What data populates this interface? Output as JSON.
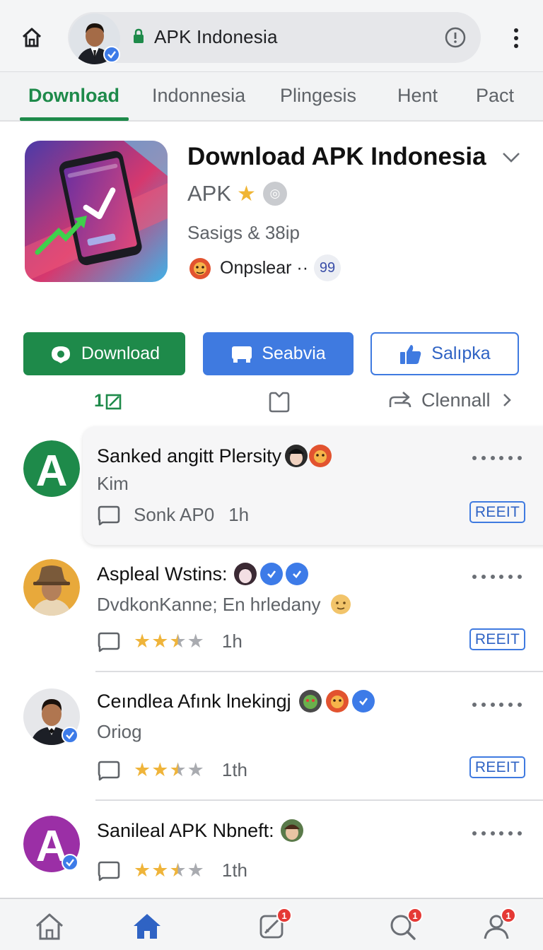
{
  "browser": {
    "url_text": "APK Indonesia"
  },
  "tabs": [
    {
      "label": "Download",
      "active": true
    },
    {
      "label": "Indonnesia",
      "active": false
    },
    {
      "label": "Plingesis",
      "active": false
    },
    {
      "label": "Hent",
      "active": false
    },
    {
      "label": "Pact",
      "active": false
    }
  ],
  "app": {
    "title": "Download APK Indonesia",
    "subtitle": "APK",
    "meta": "Sasigs & 38ip",
    "developer": "Onpslear ··",
    "developer_count": "99"
  },
  "actions": {
    "download_label": "Download",
    "seabvia_label": "Seabvia",
    "salipka_label": "Salıpka"
  },
  "quick": {
    "left_label": "1",
    "right_label": "Clennall"
  },
  "items": [
    {
      "title": "Sanked angitt Plersity",
      "subtitle": "Kim",
      "footer_text": "Sonk AP0",
      "time": "1h",
      "reply_label": "REEIT",
      "avatar_letter": "A",
      "avatar_color": "#1e8a4a"
    },
    {
      "title": "Aspleal Wstins:",
      "subtitle": "DvdkonKanne; En hrledany",
      "rating": 2.5,
      "time": "1h",
      "reply_label": "REEIT"
    },
    {
      "title": "Ceındlea Afınk lnekingj",
      "subtitle": "Oriog",
      "rating": 2.5,
      "time": "1th",
      "reply_label": "REEIT"
    },
    {
      "title": "Sanileal APK Nbneft:",
      "rating": 2.5,
      "time": "1th",
      "avatar_letter": "A",
      "avatar_color": "#9b2fa6"
    }
  ],
  "colors": {
    "accent_green": "#1e8a4a",
    "accent_blue": "#3f7ae0",
    "star": "#efb43a",
    "badge_red": "#e53935"
  },
  "icons": [
    "home-icon",
    "lock-icon",
    "info-icon",
    "more-vert-icon",
    "chevron-down-icon",
    "star-icon",
    "download-icon",
    "chat-icon",
    "thumbs-up-icon",
    "edit-icon",
    "bookmark-icon",
    "share-icon",
    "chevron-right-icon",
    "comment-icon",
    "user-icon",
    "search-icon"
  ],
  "bottom_nav": [
    {
      "label": "",
      "badge": ""
    },
    {
      "label": "",
      "badge": ""
    },
    {
      "label": "",
      "badge": "1"
    },
    {
      "label": "",
      "badge": "1"
    },
    {
      "label": "",
      "badge": "1"
    }
  ]
}
